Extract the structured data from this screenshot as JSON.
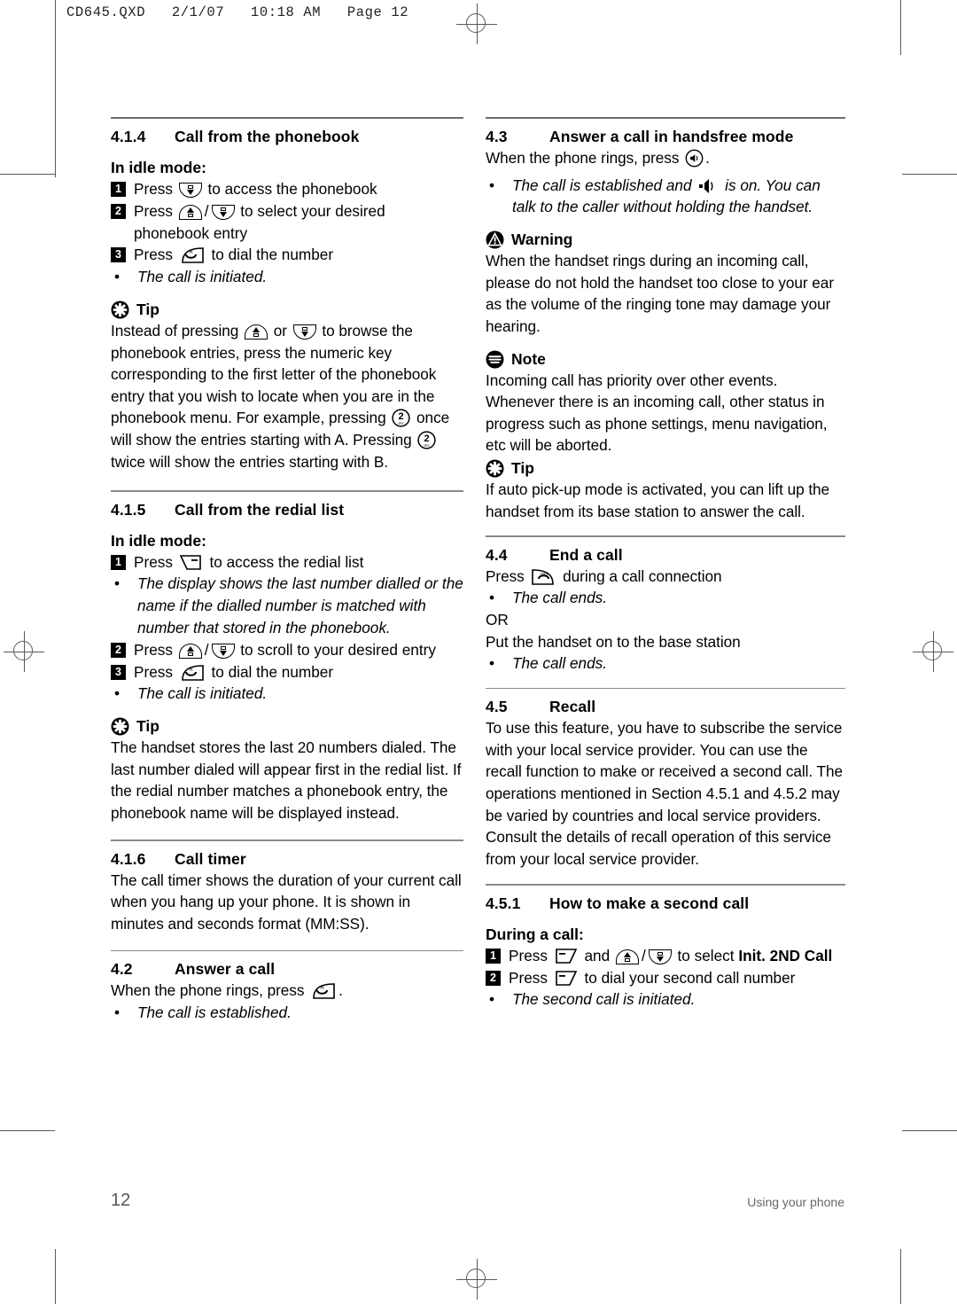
{
  "header": {
    "filemark": "CD645.QXD   2/1/07   10:18 AM   Page 12"
  },
  "footer": {
    "page_number": "12",
    "running_title": "Using your phone"
  },
  "left_column": {
    "s414": {
      "number": "4.1.4",
      "title": "Call from the phonebook",
      "subhead": "In idle mode:",
      "step1_a": "Press",
      "step1_b": "to access the phonebook",
      "step2_a": "Press",
      "step2_b": "to select your desired phonebook entry",
      "step3_a": "Press",
      "step3_b": "to dial the number",
      "bullet1": "The call is initiated."
    },
    "tip1": {
      "label": "Tip",
      "t1": "Instead of pressing",
      "t2": "or",
      "t3": "to browse the phonebook entries, press the numeric key corresponding to the first letter of the phonebook entry that you wish to locate when you are in the phonebook menu.  For example, pressing",
      "t4": "once will show the entries starting with A. Pressing",
      "t5": "twice will show the entries starting with B."
    },
    "s415": {
      "number": "4.1.5",
      "title": "Call from the redial list",
      "subhead": "In idle mode:",
      "step1_a": "Press",
      "step1_b": "to access the redial list",
      "bullet1": "The display shows the last number dialled or the name if the dialled number is matched with number that stored in the phonebook.",
      "step2_a": "Press",
      "step2_b": "to scroll to your desired entry",
      "step3_a": "Press",
      "step3_b": "to dial the number",
      "bullet2": "The call is initiated."
    },
    "tip2": {
      "label": "Tip",
      "text": "The handset stores the last 20 numbers dialed. The last number dialed will appear first in the redial list. If the redial number matches a phonebook entry, the phonebook name will be displayed instead."
    },
    "s416": {
      "number": "4.1.6",
      "title": "Call timer",
      "text": "The call timer shows the duration of your current call when you hang up your phone. It is shown in minutes and seconds format (MM:SS)."
    },
    "s42": {
      "number": "4.2",
      "title": "Answer a call",
      "t1": "When the phone rings, press",
      "t2": ".",
      "bullet1": "The call is established."
    }
  },
  "right_column": {
    "s43": {
      "number": "4.3",
      "title": "Answer a call in handsfree mode",
      "t1": "When the phone rings, press",
      "t2": ".",
      "bullet1_a": "The call is established and",
      "bullet1_b": "is on. You can talk to the caller without holding the handset."
    },
    "warning": {
      "label": "Warning",
      "text": "When the handset rings during an incoming call, please do not hold the handset too close to your ear as the volume of the ringing tone may damage your hearing."
    },
    "note": {
      "label": "Note",
      "text": "Incoming call has priority over other events. Whenever there is an incoming call, other status in progress such as phone settings, menu navigation, etc will be aborted."
    },
    "tip3": {
      "label": "Tip",
      "text": "If auto pick-up mode is activated, you can lift up the handset from its base station to answer the call."
    },
    "s44": {
      "number": "4.4",
      "title": "End a call",
      "t1": "Press",
      "t2": "during a call connection",
      "bullet1": "The call ends.",
      "or": "OR",
      "t3": "Put the handset on to the base station",
      "bullet2": "The call ends."
    },
    "s45": {
      "number": "4.5",
      "title": "Recall",
      "text": "To use this feature, you have to subscribe the service with your local service provider. You can use the recall function to make or received a second call. The operations mentioned in Section 4.5.1 and 4.5.2 may be varied by countries and local service providers. Consult the details of recall operation of this service from your local service provider."
    },
    "s451": {
      "number": "4.5.1",
      "title": "How to make a second call",
      "subhead": "During a call:",
      "step1_a": "Press",
      "step1_b": "and",
      "step1_c": "to select",
      "step1_d": "Init. 2ND Call",
      "step2_a": "Press",
      "step2_b": "to dial your second call number",
      "bullet1": "The second call is initiated."
    }
  },
  "icons": {
    "nav_down": "nav-down-key-icon",
    "nav_up": "nav-up-key-icon",
    "talk": "talk-key-icon",
    "end": "end-call-key-icon",
    "soft_left": "left-soft-key-icon",
    "soft_right": "right-soft-key-icon",
    "speaker_circle": "handsfree-key-icon",
    "speaker": "speaker-on-icon",
    "key2": "numeric-key-2-icon",
    "tip": "tip-icon",
    "warning": "warning-icon",
    "note": "note-icon"
  },
  "colors": {
    "text": "#000000",
    "rule": "#6e6e6e",
    "crop": "#5a5a5a",
    "footer": "#666666"
  }
}
